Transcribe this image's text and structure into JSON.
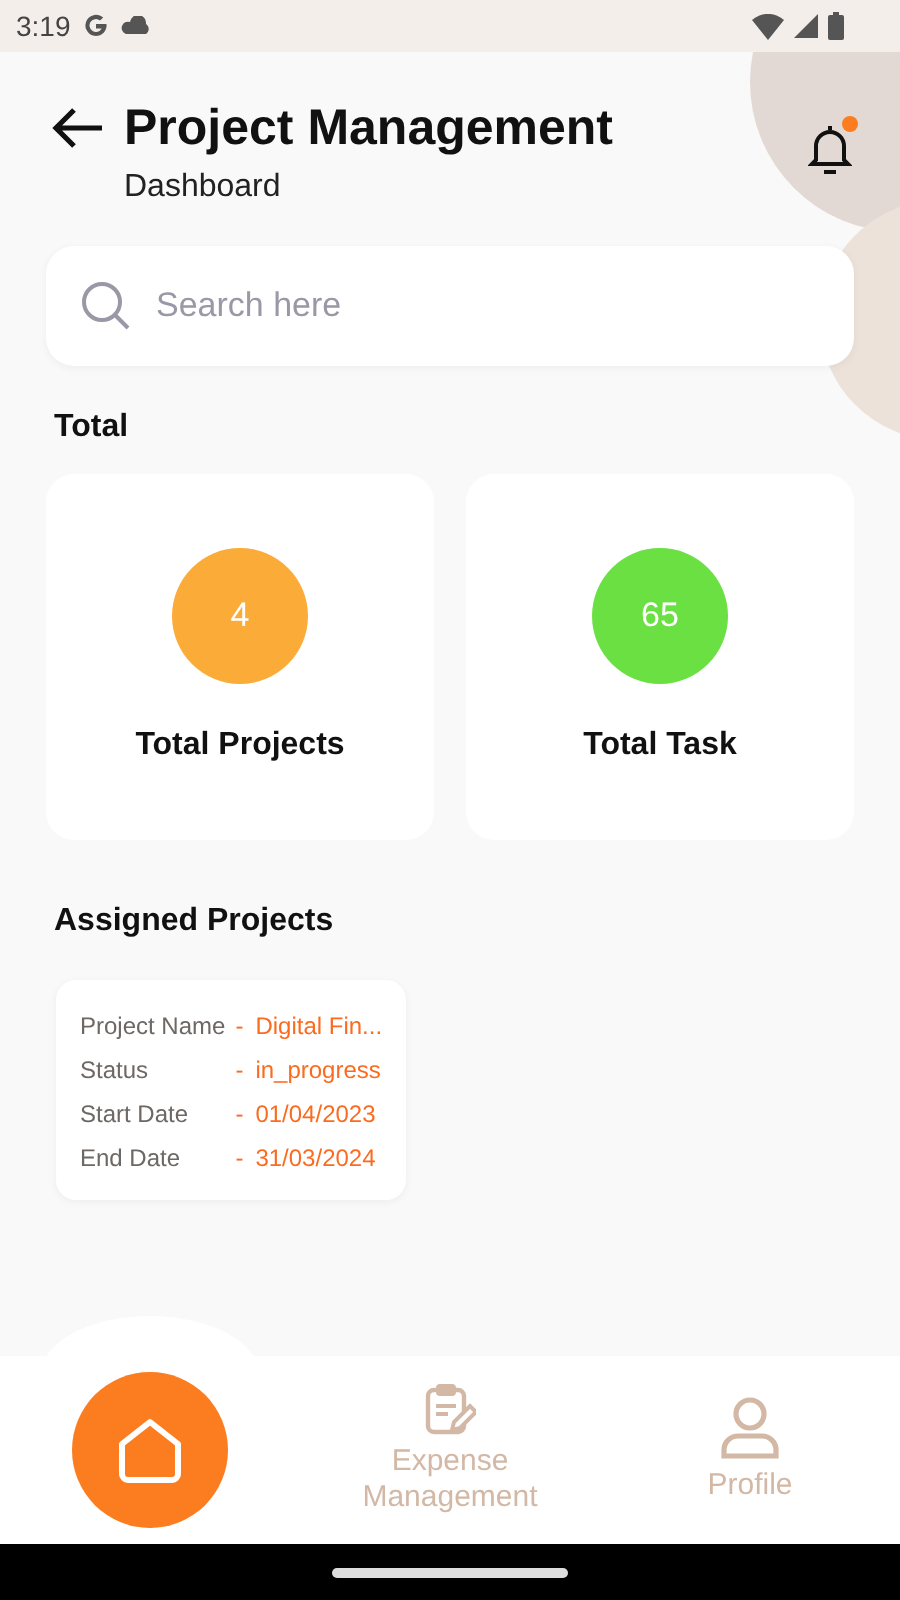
{
  "status_bar": {
    "time": "3:19"
  },
  "header": {
    "title": "Project Management",
    "subtitle": "Dashboard",
    "notification_dot": true
  },
  "search": {
    "placeholder": "Search here"
  },
  "totals": {
    "heading": "Total",
    "cards": [
      {
        "value": "4",
        "label": "Total Projects",
        "color": "#fbab38"
      },
      {
        "value": "65",
        "label": "Total Task",
        "color": "#6ae043"
      }
    ]
  },
  "assigned": {
    "heading": "Assigned Projects",
    "projects": [
      {
        "fields": [
          {
            "label": "Project Name",
            "separator": "-",
            "value": "Digital Fin..."
          },
          {
            "label": "Status",
            "separator": "-",
            "value": "in_progress"
          },
          {
            "label": "Start Date",
            "separator": "-",
            "value": "01/04/2023"
          },
          {
            "label": "End Date",
            "separator": "-",
            "value": "31/03/2024"
          }
        ]
      }
    ]
  },
  "nav": [
    {
      "kind": "home",
      "selected": true
    },
    {
      "kind": "expense",
      "label": "Expense Management",
      "selected": false
    },
    {
      "kind": "profile",
      "label": "Profile",
      "selected": false
    }
  ]
}
